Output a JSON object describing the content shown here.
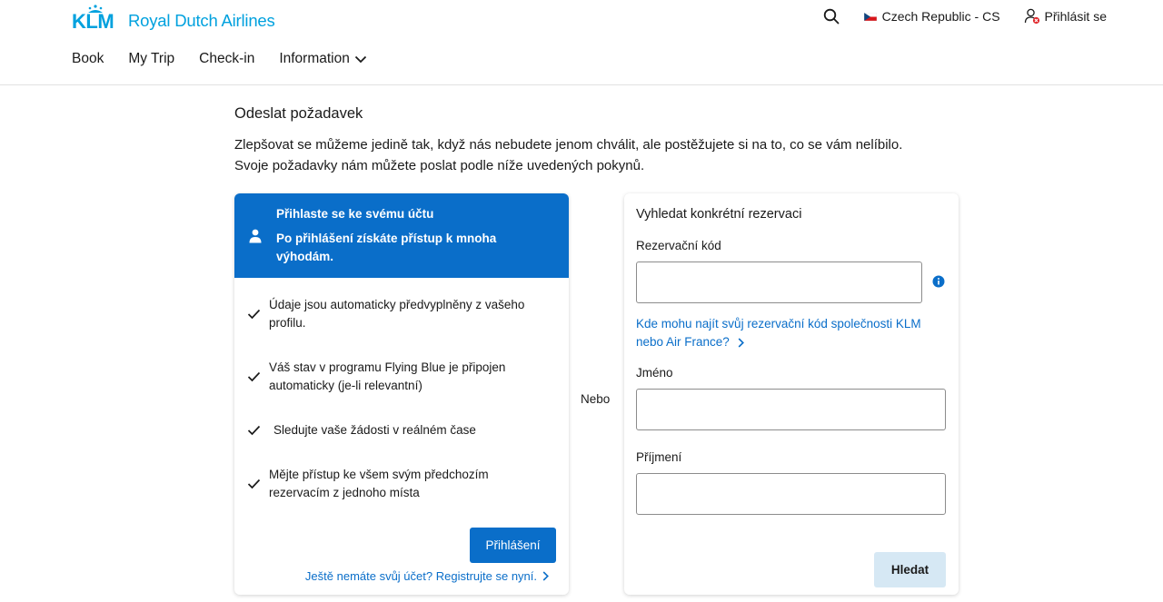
{
  "header": {
    "logo_text": "KLM",
    "logo_subtitle": "Royal Dutch Airlines",
    "country_label": "Czech Republic - CS",
    "login_label": "Přihlásit se",
    "nav": [
      {
        "label": "Book"
      },
      {
        "label": "My Trip"
      },
      {
        "label": "Check-in"
      },
      {
        "label": "Information"
      }
    ]
  },
  "page": {
    "title": "Odeslat požadavek",
    "intro_line1": "Zlepšovat se můžeme jedině tak, když nás nebudete jenom chválit, ale postěžujete si na to, co se vám nelíbilo.",
    "intro_line2": "Svoje požadavky nám můžete poslat podle níže uvedených pokynů.",
    "or_label": "Nebo"
  },
  "login_card": {
    "banner_title": "Přihlaste se ke svému účtu",
    "banner_subtitle": "Po přihlášení získáte přístup k mnoha výhodám.",
    "benefits": [
      "Údaje jsou automaticky předvyplněny z vašeho profilu.",
      "Váš stav v programu Flying Blue je připojen automaticky (je-li relevantní)",
      "Sledujte vaše žádosti v reálném čase",
      "Mějte přístup ke všem svým předchozím rezervacím z jednoho místa"
    ],
    "login_button": "Přihlášení",
    "register_link": "Ještě nemáte svůj účet? Registrujte se nyní."
  },
  "search_card": {
    "title": "Vyhledat konkrétní rezervaci",
    "booking_code_label": "Rezervační kód",
    "booking_code_value": "",
    "help_link": "Kde mohu najít svůj rezervační kód společnosti KLM nebo Air France?",
    "first_name_label": "Jméno",
    "first_name_value": "",
    "last_name_label": "Příjmení",
    "last_name_value": "",
    "search_button": "Hledat"
  },
  "colors": {
    "brand_blue": "#00a1de",
    "primary_blue": "#0a6ec9",
    "secondary_button": "#d6e8f4"
  },
  "icons": {
    "search": "search-icon",
    "flag": "czech-flag-icon",
    "login": "user-icon",
    "user_banner": "person-icon",
    "check": "check-icon",
    "info": "info-icon",
    "chevron": "chevron-right-icon"
  }
}
